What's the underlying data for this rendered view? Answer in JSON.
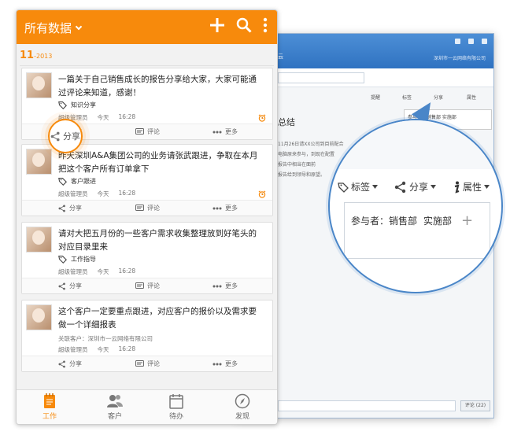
{
  "desktop": {
    "company": "深圳市一云网络有限公司",
    "tab": "云",
    "tools": [
      "提醒",
      "标签",
      "分享",
      "属性"
    ],
    "summary": "总结",
    "lines": [
      "11月26日请XX公司到目前配合",
      "电脑原来参与，到现在配置",
      "报告中相当在面前",
      "报告给到领导和原望。"
    ],
    "popup": "参与者：销售部   实施部",
    "comment_button": "评论 (22)"
  },
  "zoom": {
    "tag_label": "标签",
    "share_label": "分享",
    "attr_label": "属性",
    "participants_label": "参与者：销售部",
    "participants_extra": "实施部"
  },
  "phone": {
    "header_title": "所有数据",
    "date_day": "11",
    "date_rest": "-2013",
    "share_highlight_label": "分享",
    "action_share": "分享",
    "action_comment": "评论",
    "action_more": "更多",
    "cards": [
      {
        "text": "一篇关于自己销售成长的报告分享给大家，大家可能通过评论来知道，感谢！",
        "tag": "知识分享",
        "author": "超级管理员",
        "day": "今天",
        "time": "16:28"
      },
      {
        "text": "昨天深圳A&A集团公司的业务请张武跟进，争取在本月把这个客户所有订单拿下",
        "tag": "客户跟进",
        "author": "超级管理员",
        "day": "今天",
        "time": "16:28"
      },
      {
        "text": "请对大把五月份的一些客户需求收集整理放到好笔头的对应目录里来",
        "tag": "工作指导",
        "author": "超级管理员",
        "day": "今天",
        "time": "16:28"
      },
      {
        "text": "这个客户一定要重点跟进，对应客户的报价以及需求要做一个详细报表",
        "related": "关联客户：深圳市一云网络有限公司",
        "author": "超级管理员",
        "day": "今天",
        "time": "16:28"
      }
    ],
    "tabs": [
      {
        "label": "工作"
      },
      {
        "label": "客户"
      },
      {
        "label": "待办"
      },
      {
        "label": "发现"
      }
    ],
    "calendar_day": "7"
  },
  "colors": {
    "accent": "#f78a0c",
    "desktop_blue": "#2f72c1",
    "zoom_ring": "#4a86c8"
  }
}
